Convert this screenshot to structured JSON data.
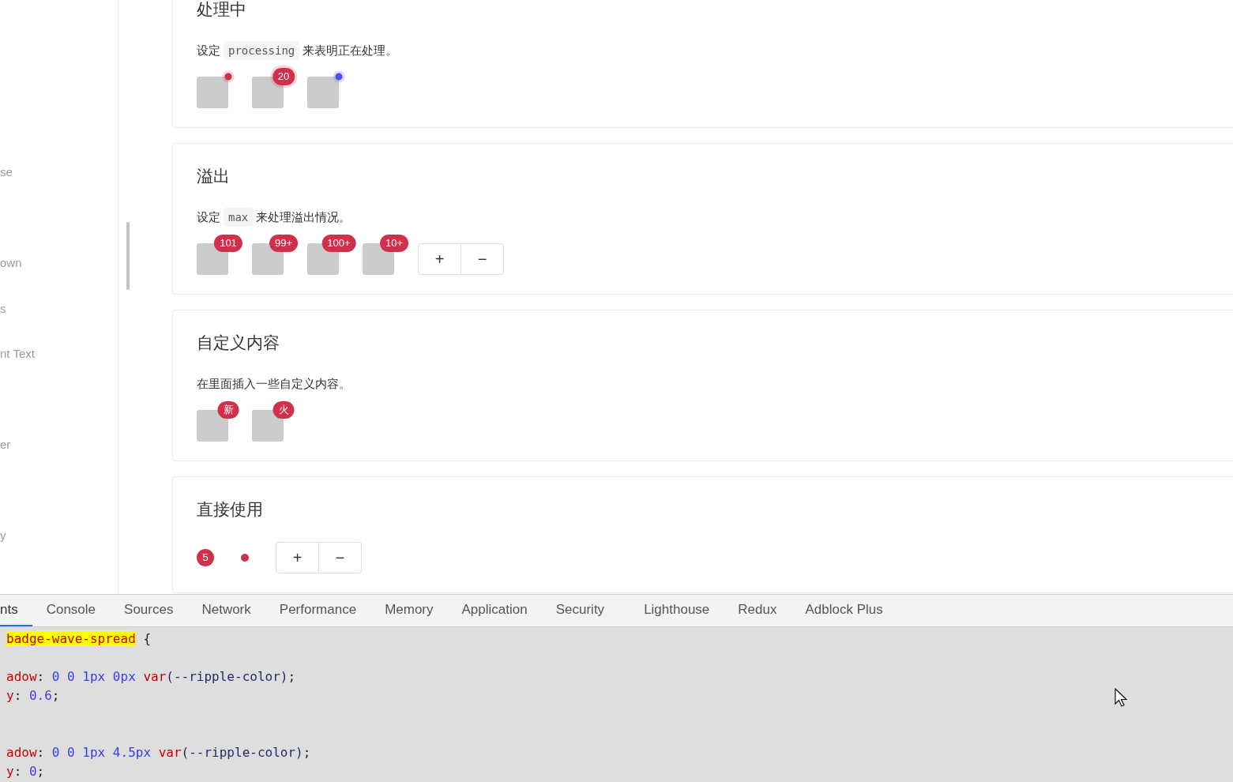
{
  "sidebar": {
    "items": [
      {
        "label": "se"
      },
      {
        "label": "own"
      },
      {
        "label": "s"
      },
      {
        "label": "nt Text"
      },
      {
        "label": "er"
      },
      {
        "label": "y"
      }
    ]
  },
  "sections": [
    {
      "kind": "avatars",
      "title": "处理中",
      "description": [
        {
          "kind": "text",
          "text": "设定"
        },
        {
          "kind": "code",
          "text": "processing"
        },
        {
          "kind": "text",
          "text": "来表明正在处理。"
        }
      ],
      "items": [
        {
          "badge": {
            "kind": "dot",
            "color": "#d0304b",
            "processing": true
          }
        },
        {
          "badge": {
            "kind": "count",
            "text": "20",
            "color": "#d0304b",
            "processing": true
          }
        },
        {
          "badge": {
            "kind": "dot",
            "color": "#5050f0",
            "processing": true
          }
        }
      ]
    },
    {
      "kind": "avatars",
      "title": "溢出",
      "description": [
        {
          "kind": "text",
          "text": "设定"
        },
        {
          "kind": "code",
          "text": "max"
        },
        {
          "kind": "text",
          "text": "来处理溢出情况。"
        }
      ],
      "items": [
        {
          "badge": {
            "kind": "count",
            "text": "101",
            "color": "#d0304b",
            "processing": false
          }
        },
        {
          "badge": {
            "kind": "count",
            "text": "99+",
            "color": "#d0304b",
            "processing": false
          }
        },
        {
          "badge": {
            "kind": "count",
            "text": "100+",
            "color": "#d0304b",
            "processing": false
          }
        },
        {
          "badge": {
            "kind": "count",
            "text": "10+",
            "color": "#d0304b",
            "processing": false
          }
        }
      ],
      "buttons": [
        {
          "label": "+"
        },
        {
          "label": "−"
        }
      ]
    },
    {
      "kind": "avatars",
      "title": "自定义内容",
      "description": [
        {
          "kind": "text",
          "text": "在里面插入一些自定义内容。"
        }
      ],
      "items": [
        {
          "badge": {
            "kind": "count",
            "text": "新",
            "color": "#d0304b",
            "processing": false
          }
        },
        {
          "badge": {
            "kind": "count",
            "text": "火",
            "color": "#d0304b",
            "processing": false
          }
        }
      ]
    },
    {
      "kind": "standalone",
      "title": "直接使用",
      "items": [
        {
          "badge": {
            "kind": "count",
            "text": "5",
            "color": "#d0304b",
            "processing": false
          }
        },
        {
          "badge": {
            "kind": "dot",
            "color": "#d0304b",
            "processing": false
          }
        }
      ],
      "buttons": [
        {
          "label": "+"
        },
        {
          "label": "−"
        }
      ]
    }
  ],
  "devtools": {
    "tabs": [
      {
        "label": "nts",
        "selected": true
      },
      {
        "label": "Console",
        "selected": false
      },
      {
        "label": "Sources",
        "selected": false
      },
      {
        "label": "Network",
        "selected": false
      },
      {
        "label": "Performance",
        "selected": false
      },
      {
        "label": "Memory",
        "selected": false
      },
      {
        "label": "Application",
        "selected": false
      },
      {
        "label": "Security",
        "selected": false
      },
      {
        "label": "Lighthouse",
        "selected": false
      },
      {
        "label": "Redux",
        "selected": false
      },
      {
        "label": "Adblock Plus",
        "selected": false
      }
    ],
    "code_lines": [
      {
        "kind": "code",
        "tokens": [
          {
            "kind": "selector",
            "text": "badge-wave-spread"
          },
          {
            "kind": "punct",
            "text": " {"
          }
        ]
      },
      {
        "kind": "offscreen"
      },
      {
        "kind": "code",
        "tokens": [
          {
            "kind": "prop",
            "text": "adow"
          },
          {
            "kind": "punct",
            "text": ": "
          },
          {
            "kind": "num",
            "text": "0 0 1px 0px "
          },
          {
            "kind": "prop",
            "text": "var"
          },
          {
            "kind": "var",
            "text": "(--ripple-color)"
          },
          {
            "kind": "punct",
            "text": ";"
          }
        ]
      },
      {
        "kind": "code",
        "tokens": [
          {
            "kind": "prop",
            "text": "y"
          },
          {
            "kind": "punct",
            "text": ": "
          },
          {
            "kind": "num",
            "text": "0.6"
          },
          {
            "kind": "punct",
            "text": ";"
          }
        ]
      },
      {
        "kind": "offscreen"
      },
      {
        "kind": "offscreen"
      },
      {
        "kind": "code",
        "tokens": [
          {
            "kind": "prop",
            "text": "adow"
          },
          {
            "kind": "punct",
            "text": ": "
          },
          {
            "kind": "num",
            "text": "0 0 1px 4.5px "
          },
          {
            "kind": "prop",
            "text": "var"
          },
          {
            "kind": "var",
            "text": "(--ripple-color)"
          },
          {
            "kind": "punct",
            "text": ";"
          }
        ]
      },
      {
        "kind": "code",
        "tokens": [
          {
            "kind": "prop",
            "text": "y"
          },
          {
            "kind": "punct",
            "text": ": "
          },
          {
            "kind": "num",
            "text": "0"
          },
          {
            "kind": "punct",
            "text": ";"
          }
        ]
      }
    ]
  }
}
